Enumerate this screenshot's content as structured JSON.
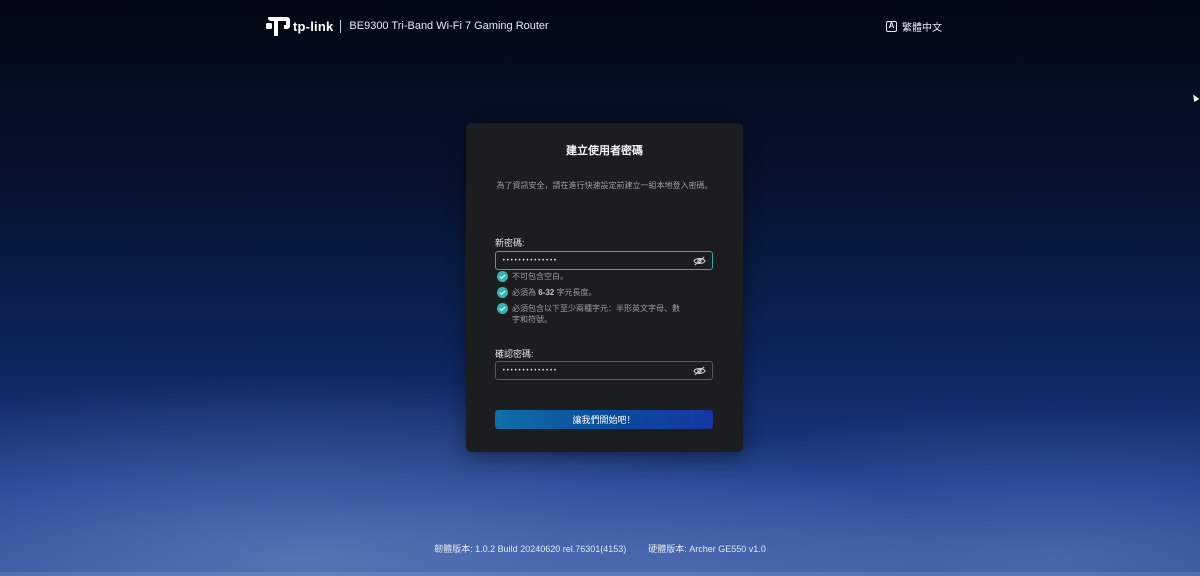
{
  "header": {
    "logo_text": "tp-link",
    "model": "BE9300 Tri-Band Wi-Fi 7 Gaming Router",
    "language_icon": "A",
    "language": "繁體中文"
  },
  "card": {
    "title": "建立使用者密碼",
    "description": "為了資訊安全，請在進行快速設定前建立一組本地登入密碼。",
    "new_password": {
      "label": "新密碼:",
      "value": "••••••••••••••"
    },
    "rules": [
      {
        "text": "不可包含空白。"
      },
      {
        "pre": "必須為 ",
        "bold": "6-32",
        "post": " 字元長度。"
      },
      {
        "text": "必須包含以下至少兩種字元：半形英文字母、數字和符號。"
      }
    ],
    "confirm_password": {
      "label": "確認密碼:",
      "value": "••••••••••••••"
    },
    "submit_label": "讓我們開始吧！"
  },
  "footer": {
    "firmware": "韌體版本: 1.0.2 Build 20240620 rel.76301(4153)",
    "hardware": "硬體版本: Archer GE550 v1.0"
  },
  "colors": {
    "accent": "#36b3b3",
    "button_start": "#0f6fa8",
    "button_end": "#1637a3",
    "card_bg": "#1c1d20"
  }
}
